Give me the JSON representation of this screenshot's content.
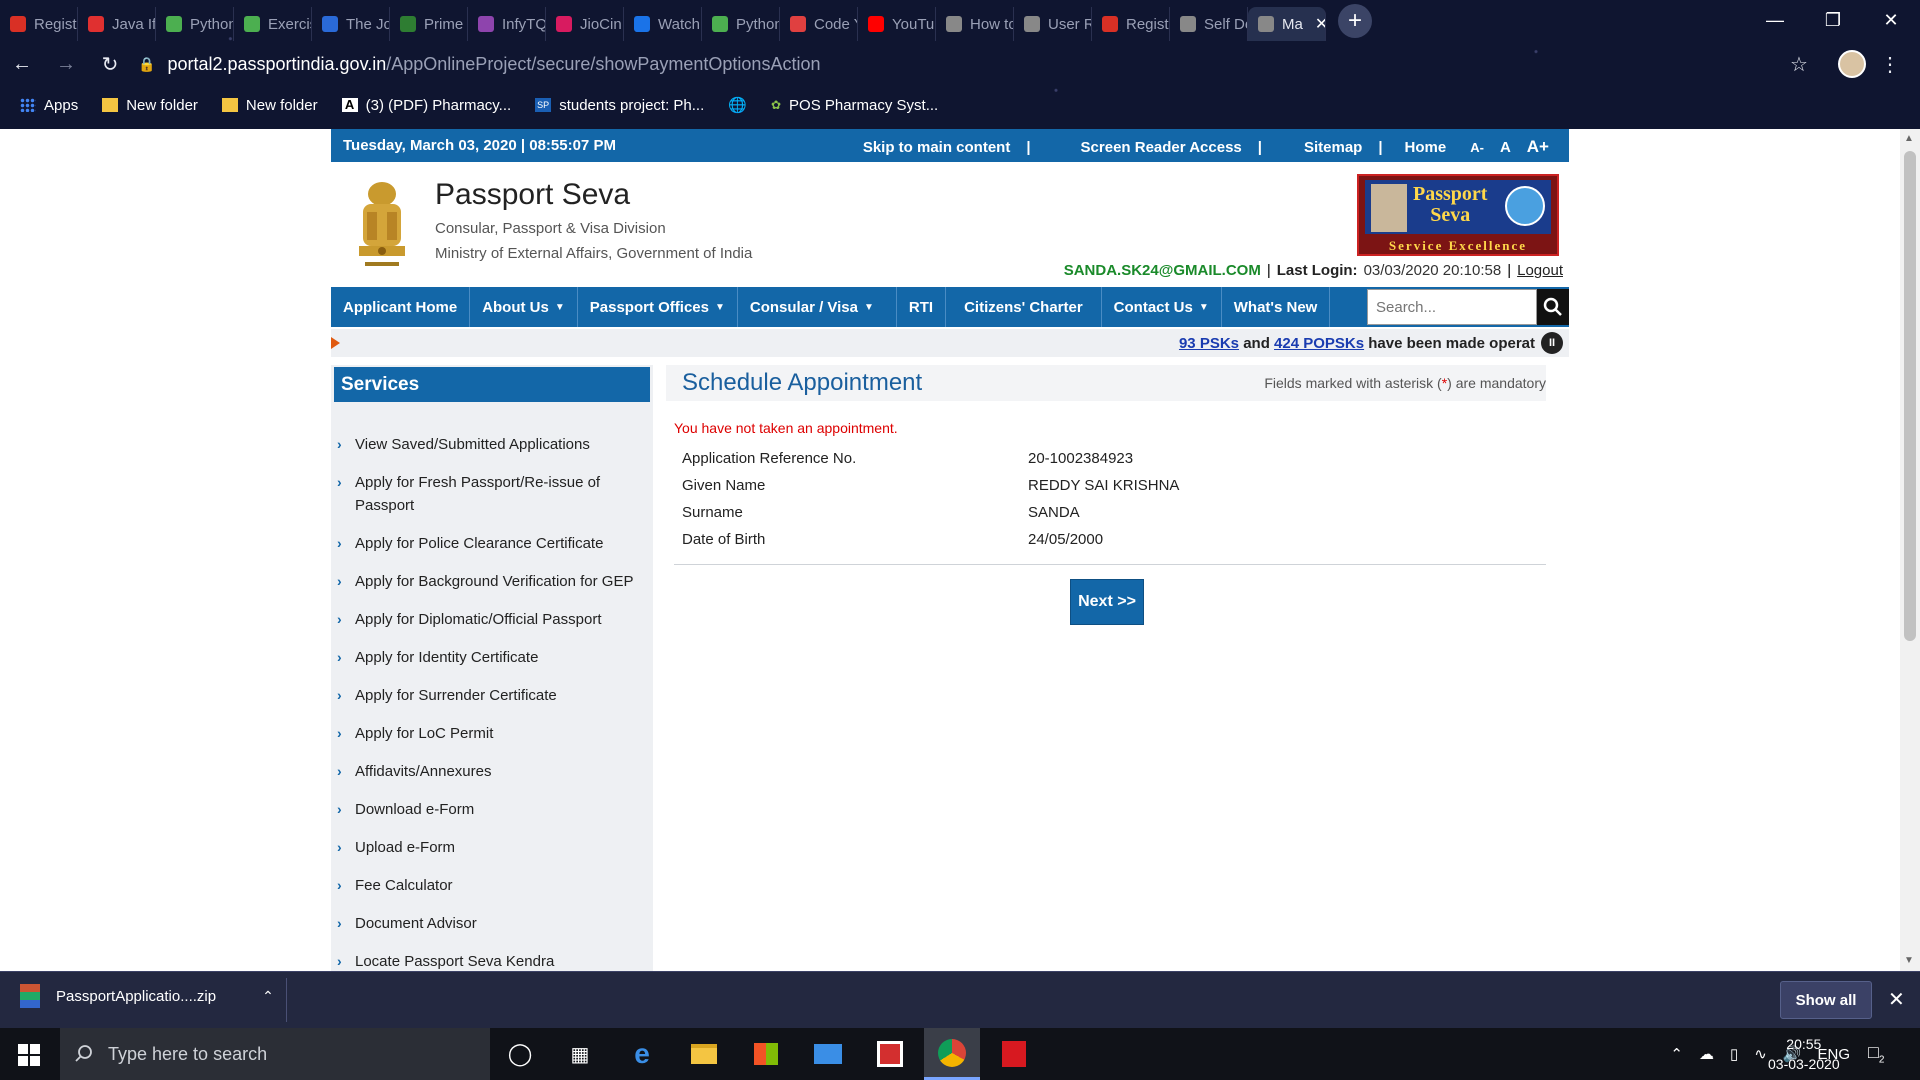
{
  "browser": {
    "tabs": [
      {
        "label": "Registr",
        "fav": "gmail",
        "color": "#d93025"
      },
      {
        "label": "Java If",
        "fav": "v",
        "color": "#e03030"
      },
      {
        "label": "Python",
        "fav": "w3",
        "color": "#4caf50"
      },
      {
        "label": "Exercis",
        "fav": "w3",
        "color": "#4caf50"
      },
      {
        "label": "The Jo",
        "fav": "s",
        "color": "#2a6ad8"
      },
      {
        "label": "Prime",
        "fav": "play",
        "color": "#2e7d32"
      },
      {
        "label": "InfyTQ",
        "fav": "q",
        "color": "#8e44ad"
      },
      {
        "label": "JioCin",
        "fav": "jio",
        "color": "#d81b60"
      },
      {
        "label": "Watch",
        "fav": "play",
        "color": "#1a73e8"
      },
      {
        "label": "Python",
        "fav": "w3",
        "color": "#4caf50"
      },
      {
        "label": "Code Y",
        "fav": "c",
        "color": "#e04040"
      },
      {
        "label": "YouTul",
        "fav": "yt",
        "color": "#ff0000"
      },
      {
        "label": "How to",
        "fav": "globe",
        "color": "#888888"
      },
      {
        "label": "User R",
        "fav": "globe",
        "color": "#888888"
      },
      {
        "label": "Regist",
        "fav": "gmail",
        "color": "#d93025"
      },
      {
        "label": "Self De",
        "fav": "globe",
        "color": "#888888"
      },
      {
        "label": "Ma",
        "fav": "globe",
        "color": "#888888",
        "active": true
      }
    ],
    "url_host": "portal2.passportindia.gov.in",
    "url_path": "/AppOnlineProject/secure/showPaymentOptionsAction",
    "bookmarks": [
      "Apps",
      "New folder",
      "New folder",
      "(3) (PDF) Pharmacy...",
      "students project: Ph...",
      "",
      "POS Pharmacy Syst..."
    ]
  },
  "topbar": {
    "date": "Tuesday,  March  03, 2020 | 08:55:07 PM",
    "skip": "Skip to main content",
    "screen_reader": "Screen Reader Access",
    "sitemap": "Sitemap",
    "home": "Home",
    "font_small": "A-",
    "font_normal": "A",
    "font_large": "A+"
  },
  "header": {
    "title": "Passport Seva",
    "sub1": "Consular, Passport & Visa Division",
    "sub2": "Ministry of External Affairs, Government of India",
    "logo_line1": "Passport",
    "logo_line2": "Seva",
    "logo_tagline": "Service Excellence",
    "email": "SANDA.SK24@GMAIL.COM",
    "last_login_label": "Last Login:",
    "last_login_value": "03/03/2020 20:10:58",
    "logout": "Logout"
  },
  "nav": {
    "items": [
      "Applicant Home",
      "About Us",
      "Passport Offices",
      "Consular / Visa",
      "RTI",
      "Citizens' Charter",
      "Contact Us",
      "What's New"
    ],
    "search_placeholder": "Search..."
  },
  "ticker": {
    "psk": "93 PSKs",
    "and": "and",
    "popsk": "424 POPSKs",
    "rest": "have been made operat"
  },
  "sidebar": {
    "title": "Services",
    "items": [
      "View Saved/Submitted Applications",
      "Apply for Fresh Passport/Re-issue of Passport",
      "Apply for Police Clearance Certificate",
      "Apply for Background Verification for GEP",
      "Apply for Diplomatic/Official Passport",
      "Apply for Identity Certificate",
      "Apply for Surrender Certificate",
      "Apply for LoC Permit",
      "Affidavits/Annexures",
      "Download e-Form",
      "Upload e-Form",
      "Fee Calculator",
      "Document Advisor",
      "Locate Passport Seva Kendra"
    ]
  },
  "content": {
    "title": "Schedule Appointment",
    "mandatory_pre": "Fields marked with asterisk (",
    "mandatory_ast": "*",
    "mandatory_post": ") are mandatory",
    "error": "You have not taken an appointment.",
    "fields": [
      {
        "label": "Application Reference No.",
        "value": "20-1002384923"
      },
      {
        "label": "Given Name",
        "value": "REDDY SAI KRISHNA"
      },
      {
        "label": "Surname",
        "value": "SANDA"
      },
      {
        "label": "Date of Birth",
        "value": "24/05/2000"
      }
    ],
    "next_label": "Next >>"
  },
  "downloads": {
    "file": "PassportApplicatio....zip",
    "show_all": "Show all"
  },
  "taskbar": {
    "search_placeholder": "Type here to search",
    "lang": "ENG",
    "time": "20:55",
    "date": "03-03-2020",
    "notif_count": "2"
  }
}
